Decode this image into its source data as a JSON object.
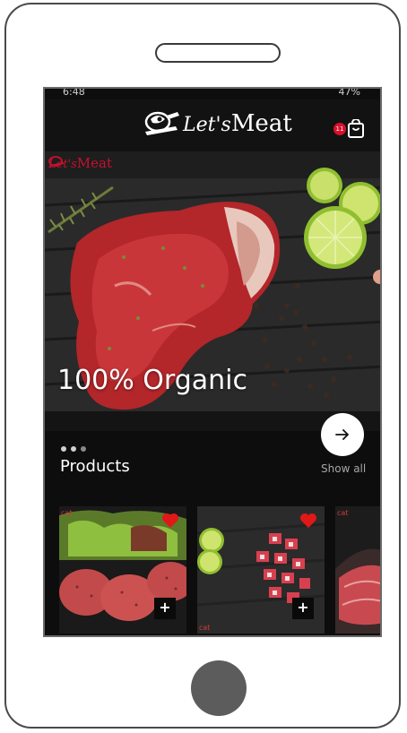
{
  "status_bar": {
    "time": "6:48",
    "right": "47%"
  },
  "header": {
    "logo_script": "Let's",
    "logo_word": "Meat",
    "cart_count": "11"
  },
  "hero": {
    "brand_script": "Let's",
    "brand_word": "Meat",
    "title": "100% Organic"
  },
  "products_section": {
    "title": "Products",
    "show_all": "Show all"
  },
  "products": [
    {
      "tag": "cat"
    },
    {
      "tag": "cat"
    },
    {
      "tag": "cat"
    }
  ],
  "colors": {
    "accent": "#d8102a",
    "background": "#0d0d0d"
  }
}
